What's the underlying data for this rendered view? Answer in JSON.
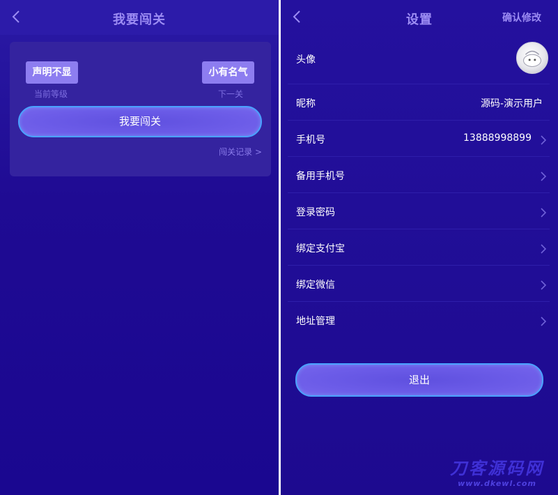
{
  "left": {
    "title": "我要闯关",
    "current_level": {
      "name": "声明不显",
      "caption": "当前等级"
    },
    "next_level": {
      "name": "小有名气",
      "caption": "下一关"
    },
    "challenge_button": "我要闯关",
    "record_link": "闯关记录 >"
  },
  "right": {
    "title": "设置",
    "confirm_button": "确认修改",
    "rows": [
      {
        "label": "头像",
        "value": "",
        "arrow": false
      },
      {
        "label": "昵称",
        "value": "源码-演示用户",
        "arrow": false
      },
      {
        "label": "手机号",
        "value": "13888998899",
        "arrow": true
      },
      {
        "label": "备用手机号",
        "value": "",
        "arrow": true
      },
      {
        "label": "登录密码",
        "value": "",
        "arrow": true
      },
      {
        "label": "绑定支付宝",
        "value": "",
        "arrow": true
      },
      {
        "label": "绑定微信",
        "value": "",
        "arrow": true
      },
      {
        "label": "地址管理",
        "value": "",
        "arrow": true
      }
    ],
    "logout_button": "退出"
  },
  "watermark": {
    "name": "刀客源码网",
    "url": "www.dkewl.com"
  },
  "icons": {
    "back": "chevron-left-icon",
    "row_arrow": "chevron-right-icon",
    "avatar": "avatar-image"
  },
  "colors": {
    "background": "#1f0b93",
    "accent": "#8d7df0",
    "button_border": "#4aa2ff"
  }
}
